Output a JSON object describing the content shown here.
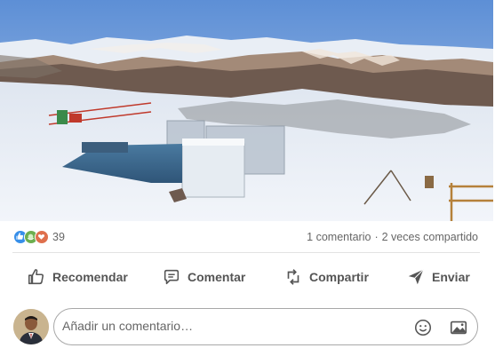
{
  "post": {
    "image_alt": "",
    "reactions": {
      "types": [
        "like-icon",
        "support-icon",
        "love-icon"
      ],
      "colors": {
        "like": "#378fe9",
        "support": "#6dae4f",
        "love": "#df704d"
      },
      "count": "39"
    },
    "comments_count": "1 comentario",
    "separator": "·",
    "shares_count": "2 veces compartido"
  },
  "actions": {
    "recommend": "Recomendar",
    "comment": "Comentar",
    "share": "Compartir",
    "send": "Enviar"
  },
  "comment_box": {
    "placeholder": "Añadir un comentario…"
  }
}
